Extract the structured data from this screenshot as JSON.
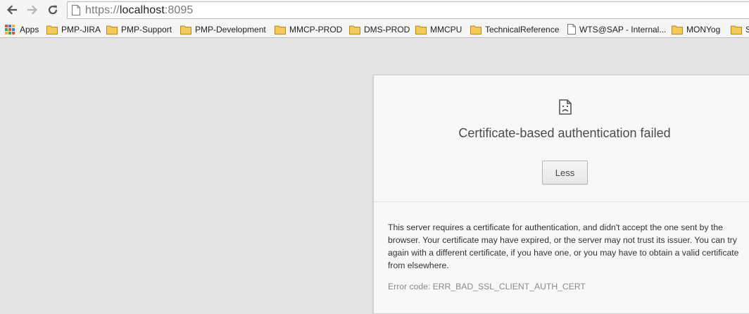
{
  "browser": {
    "url_scheme": "https://",
    "url_host": "localhost",
    "url_port": ":8095"
  },
  "bookmarks": [
    {
      "label": "Apps",
      "kind": "apps"
    },
    {
      "label": "PMP-JIRA",
      "kind": "folder"
    },
    {
      "label": "PMP-Support",
      "kind": "folder"
    },
    {
      "label": "PMP-Development",
      "kind": "folder"
    },
    {
      "label": "MMCP-PROD",
      "kind": "folder"
    },
    {
      "label": "DMS-PROD",
      "kind": "folder"
    },
    {
      "label": "MMCPU",
      "kind": "folder"
    },
    {
      "label": "TechnicalReference",
      "kind": "folder"
    },
    {
      "label": "WTS@SAP - Internal...",
      "kind": "page"
    },
    {
      "label": "MONYog",
      "kind": "folder"
    },
    {
      "label": "S",
      "kind": "folder"
    }
  ],
  "error": {
    "icon": "sad-page-icon",
    "title": "Certificate-based authentication failed",
    "less_label": "Less",
    "details": "This server requires a certificate for authentication, and didn't accept the one sent by the browser. Your certificate may have expired, or the server may not trust its issuer. You can try again with a different certificate, if you have one, or you may have to obtain a valid certificate from elsewhere.",
    "code": "Error code: ERR_BAD_SSL_CLIENT_AUTH_CERT"
  },
  "colors": {
    "page_background": "#e5e5e5",
    "folder_fill": "#f3c95a",
    "apps_grid": [
      "#e74c3c",
      "#3b7ddd",
      "#f2b134",
      "#2eaa4e",
      "#e74c3c",
      "#3b7ddd",
      "#f2b134",
      "#2eaa4e",
      "#e74c3c"
    ]
  }
}
